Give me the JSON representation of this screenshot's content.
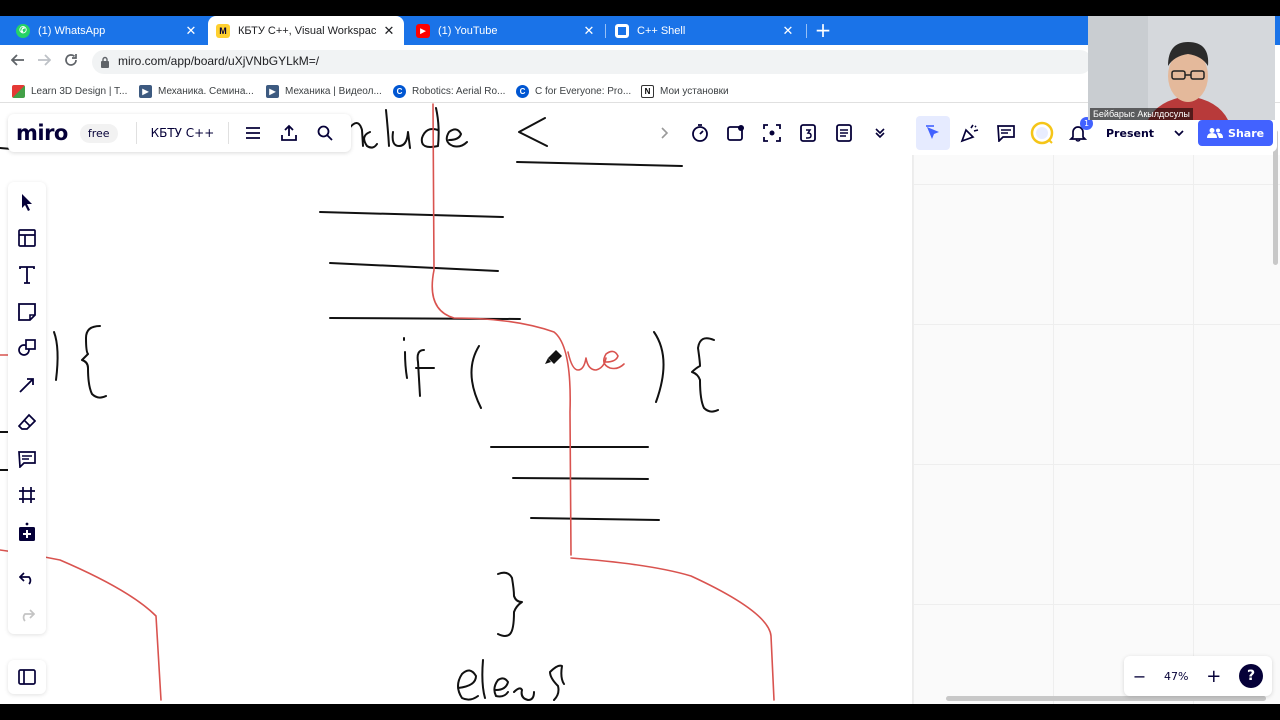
{
  "browser": {
    "tabs": [
      {
        "title": "(1) WhatsApp",
        "icon": "whatsapp-icon",
        "active": false
      },
      {
        "title": "КБТУ C++, Visual Workspace for",
        "icon": "miro-icon",
        "active": true
      },
      {
        "title": "(1) YouTube",
        "icon": "youtube-icon",
        "active": false
      },
      {
        "title": "C++ Shell",
        "icon": "cpp-shell-icon",
        "active": false
      }
    ],
    "close_glyph": "✕",
    "newtab_glyph": "+",
    "url": "miro.com/app/board/uXjVNbGYLkM=/",
    "bookmarks": [
      {
        "label": "Learn 3D Design | T...",
        "icon": "grid-icon"
      },
      {
        "label": "Механика. Семина...",
        "icon": "video-icon"
      },
      {
        "label": "Механика | Видеол...",
        "icon": "video-icon"
      },
      {
        "label": "Robotics: Aerial Ro...",
        "icon": "coursera-icon"
      },
      {
        "label": "C for Everyone: Pro...",
        "icon": "coursera-icon"
      },
      {
        "label": "Мои установки",
        "icon": "notion-icon"
      }
    ]
  },
  "miro": {
    "logo": "miro",
    "plan_badge": "free",
    "board_name": "КБТУ C++",
    "present_label": "Present",
    "share_label": "Share",
    "notification_count": "1",
    "zoom_level": "47%",
    "zoom_minus": "−",
    "zoom_plus": "+",
    "help": "?"
  },
  "webcam": {
    "name": "Бейбарыс Акылдосулы"
  },
  "colors": {
    "tab_strip": "#1a73e8",
    "miro_navy": "#050038",
    "share_blue": "#4262ff",
    "ink_black": "#111111",
    "ink_red": "#d9534f"
  }
}
